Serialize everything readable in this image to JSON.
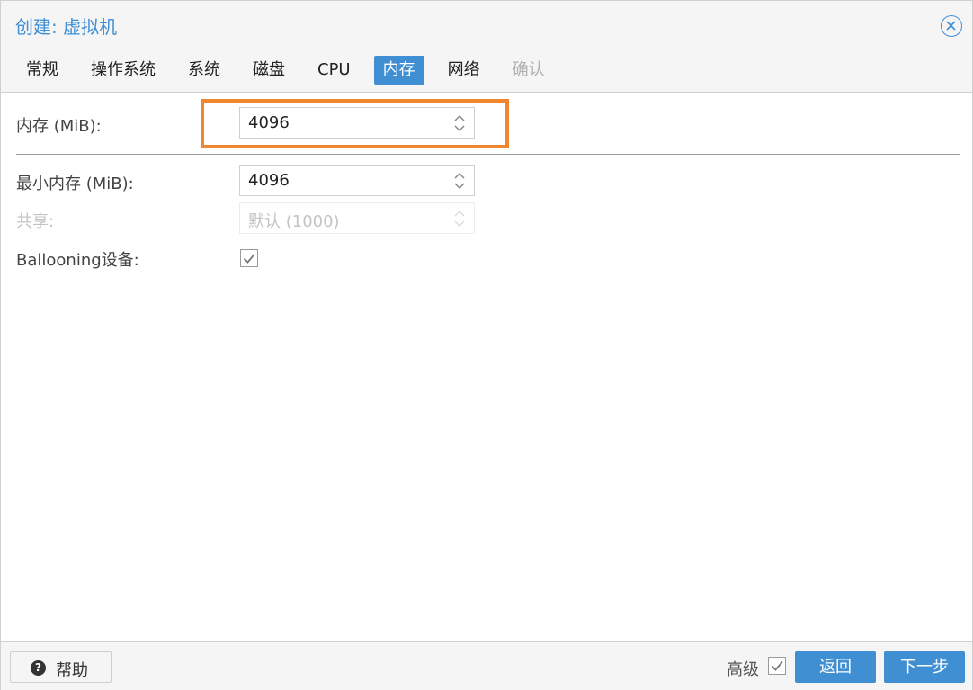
{
  "window": {
    "title": "创建: 虚拟机"
  },
  "tabs": [
    {
      "label": "常规",
      "state": "normal"
    },
    {
      "label": "操作系统",
      "state": "normal"
    },
    {
      "label": "系统",
      "state": "normal"
    },
    {
      "label": "磁盘",
      "state": "normal"
    },
    {
      "label": "CPU",
      "state": "normal"
    },
    {
      "label": "内存",
      "state": "active"
    },
    {
      "label": "网络",
      "state": "normal"
    },
    {
      "label": "确认",
      "state": "disabled"
    }
  ],
  "form": {
    "memory": {
      "label": "内存 (MiB):",
      "value": "4096"
    },
    "min_memory": {
      "label": "最小内存 (MiB):",
      "value": "4096"
    },
    "shares": {
      "label": "共享:",
      "placeholder": "默认 (1000)",
      "disabled": true
    },
    "ballooning": {
      "label": "Ballooning设备:",
      "checked": true
    }
  },
  "footer": {
    "help_label": "帮助",
    "help_icon": "?",
    "advanced_label": "高级",
    "advanced_checked": true,
    "back_label": "返回",
    "next_label": "下一步"
  },
  "colors": {
    "accent": "#3f8fd2",
    "highlight": "#f0872e"
  }
}
